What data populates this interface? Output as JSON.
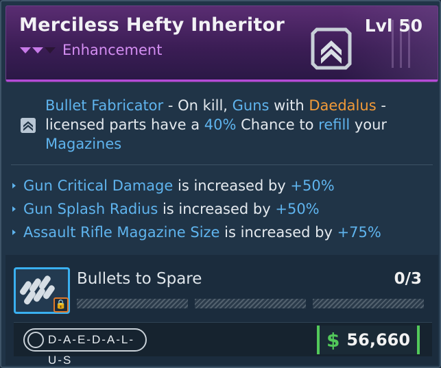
{
  "header": {
    "title": "Merciless Hefty Inheritor",
    "level": "Lvl 50",
    "subtype": "Enhancement",
    "rarity_color": "#c77ae8",
    "class_icon": "chevron-rank-icon"
  },
  "skill": {
    "icon": "chevron-rank-icon",
    "parts": [
      {
        "text": "Bullet Fabricator",
        "style": "blue"
      },
      {
        "text": " - On kill, ",
        "style": "plain"
      },
      {
        "text": "Guns",
        "style": "blue"
      },
      {
        "text": " with ",
        "style": "plain"
      },
      {
        "text": "Daedalus",
        "style": "orange"
      },
      {
        "text": " -licensed parts have a ",
        "style": "plain"
      },
      {
        "text": "40%",
        "style": "blue"
      },
      {
        "text": " Chance to ",
        "style": "plain"
      },
      {
        "text": "refill",
        "style": "blue"
      },
      {
        "text": " your ",
        "style": "plain"
      },
      {
        "text": "Magazines",
        "style": "blue"
      }
    ]
  },
  "stats": [
    {
      "stat": "Gun Critical Damage",
      "mid": " is increased by ",
      "value": "+50%"
    },
    {
      "stat": "Gun Splash Radius",
      "mid": " is increased by ",
      "value": "+50%"
    },
    {
      "stat": "Assault Rifle Magazine Size",
      "mid": " is increased by ",
      "value": "+75%"
    }
  ],
  "perk": {
    "name": "Bullets to Spare",
    "count": "0/3",
    "progress_filled": 0,
    "progress_total": 3,
    "icon": "bullets-icon",
    "lock_icon": "lock-icon"
  },
  "footer": {
    "manufacturer": "D-A-E-D-A-L-U-S",
    "currency_symbol": "$",
    "price": "56,660",
    "price_color": "#52c95a"
  }
}
